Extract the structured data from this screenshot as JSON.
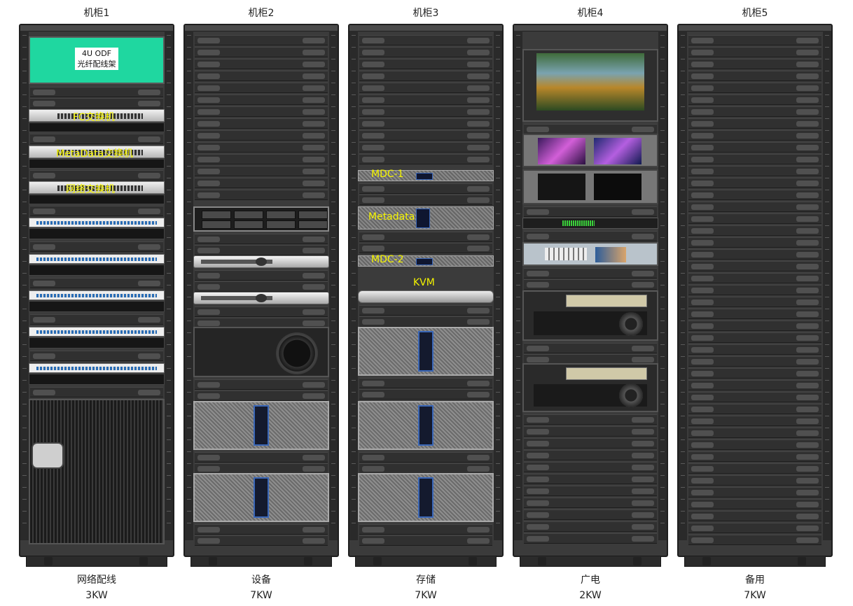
{
  "racks": [
    {
      "title": "机柜1",
      "role": "网络配线",
      "power": "3KW"
    },
    {
      "title": "机柜2",
      "role": "设备",
      "power": "7KW"
    },
    {
      "title": "机柜3",
      "role": "存储",
      "power": "7KW"
    },
    {
      "title": "机柜4",
      "role": "广电",
      "power": "2KW"
    },
    {
      "title": "机柜5",
      "role": "备用",
      "power": "7KW"
    }
  ],
  "rack1": {
    "odf_line1": "4U ODF",
    "odf_line2": "光纤配线架",
    "fc_switch": "FC交换机",
    "metadata_switch": "MetaData交换机",
    "network_switch": "网络交换机"
  },
  "rack3": {
    "mdc1": "MDC-1",
    "metadata": "Metadata",
    "mdc2": "MDC-2",
    "kvm": "KVM"
  },
  "colors": {
    "label_yellow": "#f4f400",
    "odf_green": "#1fd7a0",
    "rack_body": "#3b3b3b"
  }
}
